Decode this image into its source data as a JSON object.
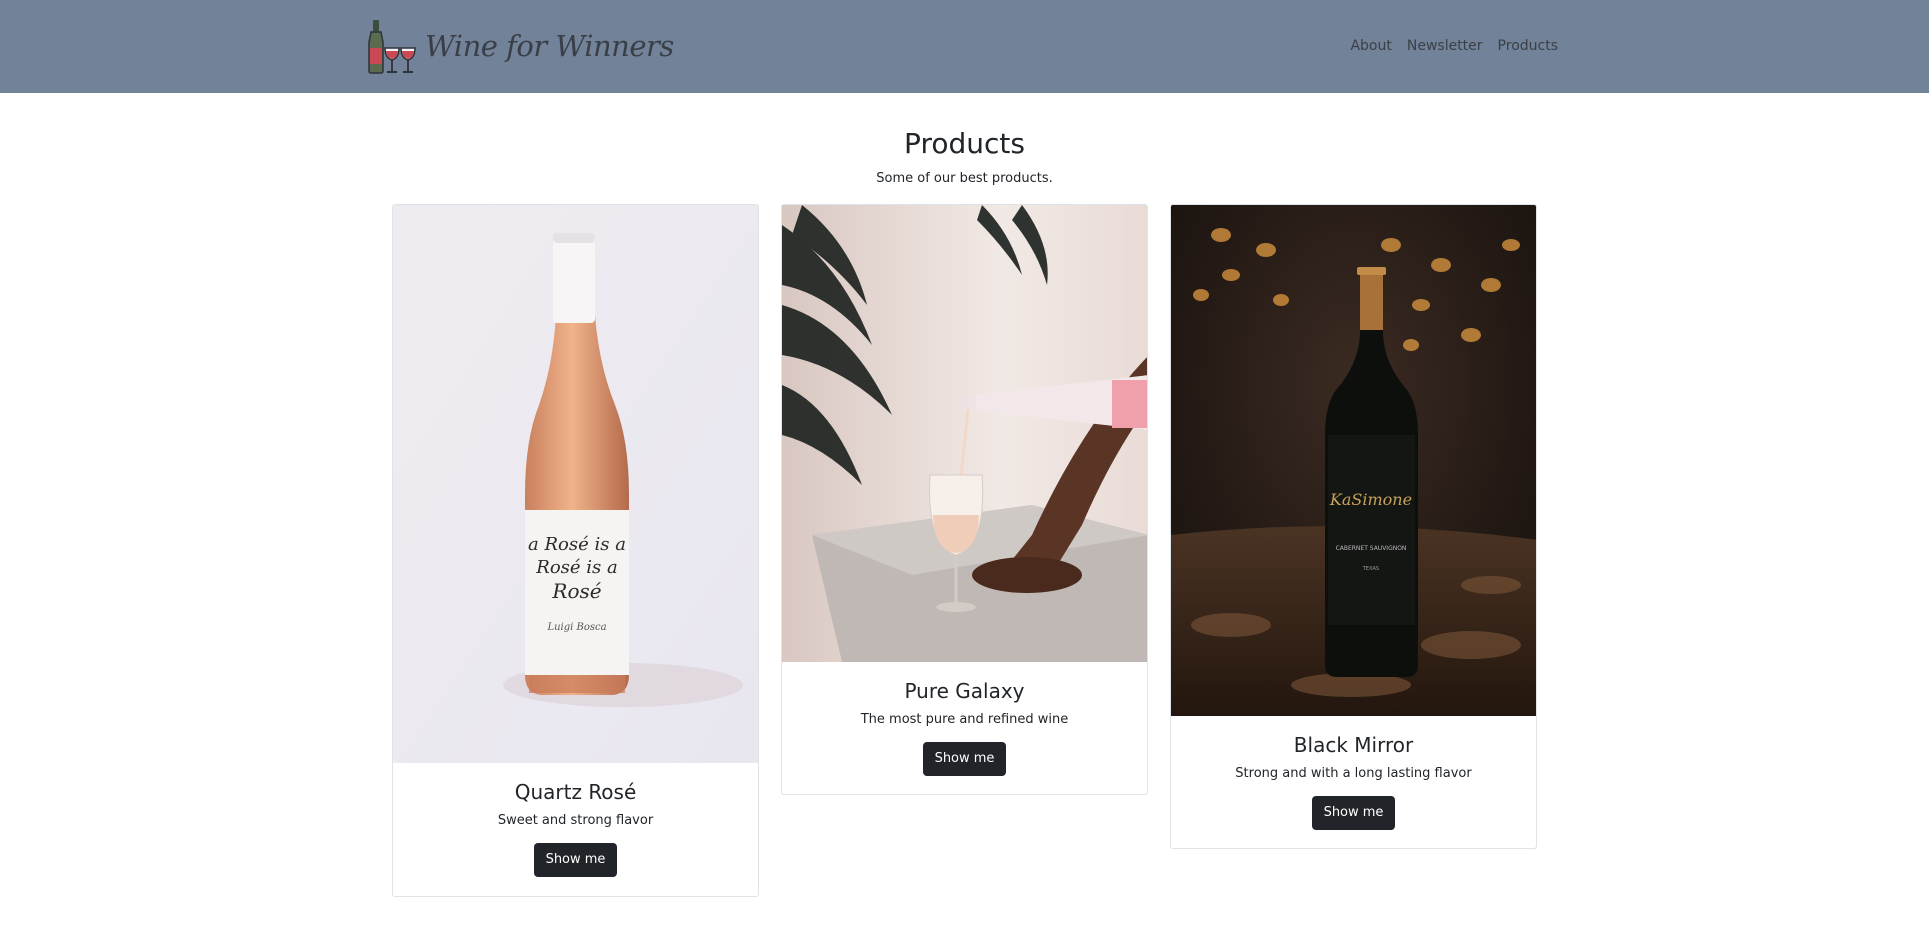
{
  "header": {
    "brand_name": "Wine for Winners",
    "nav": [
      {
        "label": "About"
      },
      {
        "label": "Newsletter"
      },
      {
        "label": "Products"
      }
    ]
  },
  "products_section": {
    "title": "Products",
    "subtitle": "Some of our best products."
  },
  "products": [
    {
      "name": "Quartz Rosé",
      "description": "Sweet and strong flavor",
      "button_label": "Show me",
      "image_icon": "rose-wine-bottle-photo"
    },
    {
      "name": "Pure Galaxy",
      "description": "The most pure and refined wine",
      "button_label": "Show me",
      "image_icon": "wine-pouring-photo"
    },
    {
      "name": "Black Mirror",
      "description": "Strong and with a long lasting flavor",
      "button_label": "Show me",
      "image_icon": "red-wine-bottle-photo"
    }
  ],
  "colors": {
    "navbar_bg": "#718299",
    "button_bg": "#212529",
    "text": "#212529"
  }
}
